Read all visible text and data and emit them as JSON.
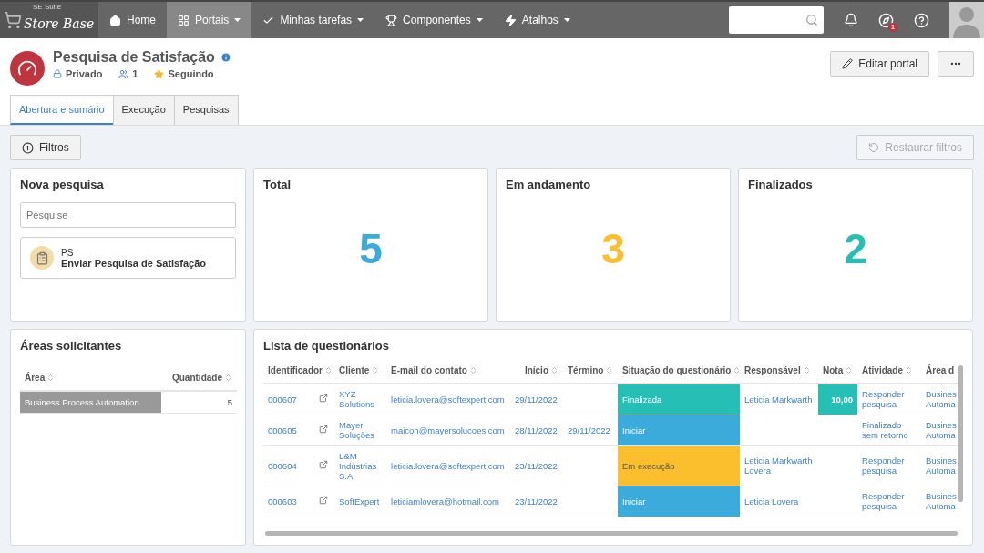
{
  "navbar": {
    "logo": {
      "small": "SE Suite",
      "name": "Store Base"
    },
    "items": [
      {
        "label": "Home",
        "dropdown": false,
        "selected": false
      },
      {
        "label": "Portais",
        "dropdown": true,
        "selected": true
      },
      {
        "label": "Minhas tarefas",
        "dropdown": true,
        "selected": false
      },
      {
        "label": "Componentes",
        "dropdown": true,
        "selected": false
      },
      {
        "label": "Atalhos",
        "dropdown": true,
        "selected": false
      }
    ],
    "badge": "1"
  },
  "portal": {
    "title": "Pesquisa de Satisfação",
    "privacy": "Privado",
    "members": "1",
    "follow": "Seguindo",
    "edit": "Editar portal"
  },
  "tabs": [
    {
      "label": "Abertura e sumário",
      "selected": true
    },
    {
      "label": "Execução",
      "selected": false
    },
    {
      "label": "Pesquisas",
      "selected": false
    }
  ],
  "filters": {
    "add": "Filtros",
    "reset": {
      "label": "Restaurar filtros",
      "disabled": true
    }
  },
  "new_survey": {
    "title": "Nova pesquisa",
    "search": {
      "placeholder": "Pesquise"
    },
    "items": [
      {
        "code": "PS",
        "label": "Enviar Pesquisa de Satisfação"
      }
    ]
  },
  "stats": [
    {
      "title": "Total",
      "value": "5",
      "color": "#3aabdb"
    },
    {
      "title": "Em andamento",
      "value": "3",
      "color": "#fbbf2d"
    },
    {
      "title": "Finalizados",
      "value": "2",
      "color": "#26bfb5"
    }
  ],
  "areas": {
    "title": "Áreas solicitantes",
    "columns": [
      "Área",
      "Quantidade"
    ],
    "rows": [
      {
        "area": "Business Process Automation",
        "count": "5"
      }
    ]
  },
  "questionnaires": {
    "title": "Lista de questionários",
    "columns": [
      "Identificador",
      "Cliente",
      "E-mail do contato",
      "Início",
      "Término",
      "Situação do questionário",
      "Responsável",
      "Nota",
      "Atividade",
      "Área d"
    ],
    "rows": [
      {
        "id": "000607",
        "client": "XYZ Solutions",
        "email": "leticia.lovera@softexpert.com",
        "start": "29/11/2022",
        "end": "",
        "status": {
          "label": "Finalizada",
          "color": "#26bfb5"
        },
        "responsible": "Leticia Markwarth",
        "score": {
          "label": "10,00",
          "color": "#26bfb5"
        },
        "activity": "Responder pesquisa",
        "area": "Busines Automa"
      },
      {
        "id": "000605",
        "client": "Mayer Soluções",
        "email": "maicon@mayersolucoes.com",
        "start": "28/11/2022",
        "end": "29/11/2022",
        "status": {
          "label": "Iniciar",
          "color": "#3aabdb"
        },
        "responsible": "",
        "activity": "Finalizado sem retorno",
        "area": "Busines Automa"
      },
      {
        "id": "000604",
        "client": "L&M Indústrias S.A",
        "email": "leticia.lovera@softexpert.com",
        "start": "23/11/2022",
        "end": "",
        "status": {
          "label": "Em execução",
          "color": "#fbbf2d"
        },
        "responsible": "Leticia Markwarth Lovera",
        "activity": "Responder pesquisa",
        "area": "Busines Automa"
      },
      {
        "id": "000603",
        "client": "SoftExpert",
        "email": "leticiamlovera@hotmail.com",
        "start": "23/11/2022",
        "end": "",
        "status": {
          "label": "Iniciar",
          "color": "#3aabdb"
        },
        "responsible": "Leticia Lovera",
        "activity": "Responder pesquisa",
        "area": "Busines Automa"
      }
    ]
  }
}
